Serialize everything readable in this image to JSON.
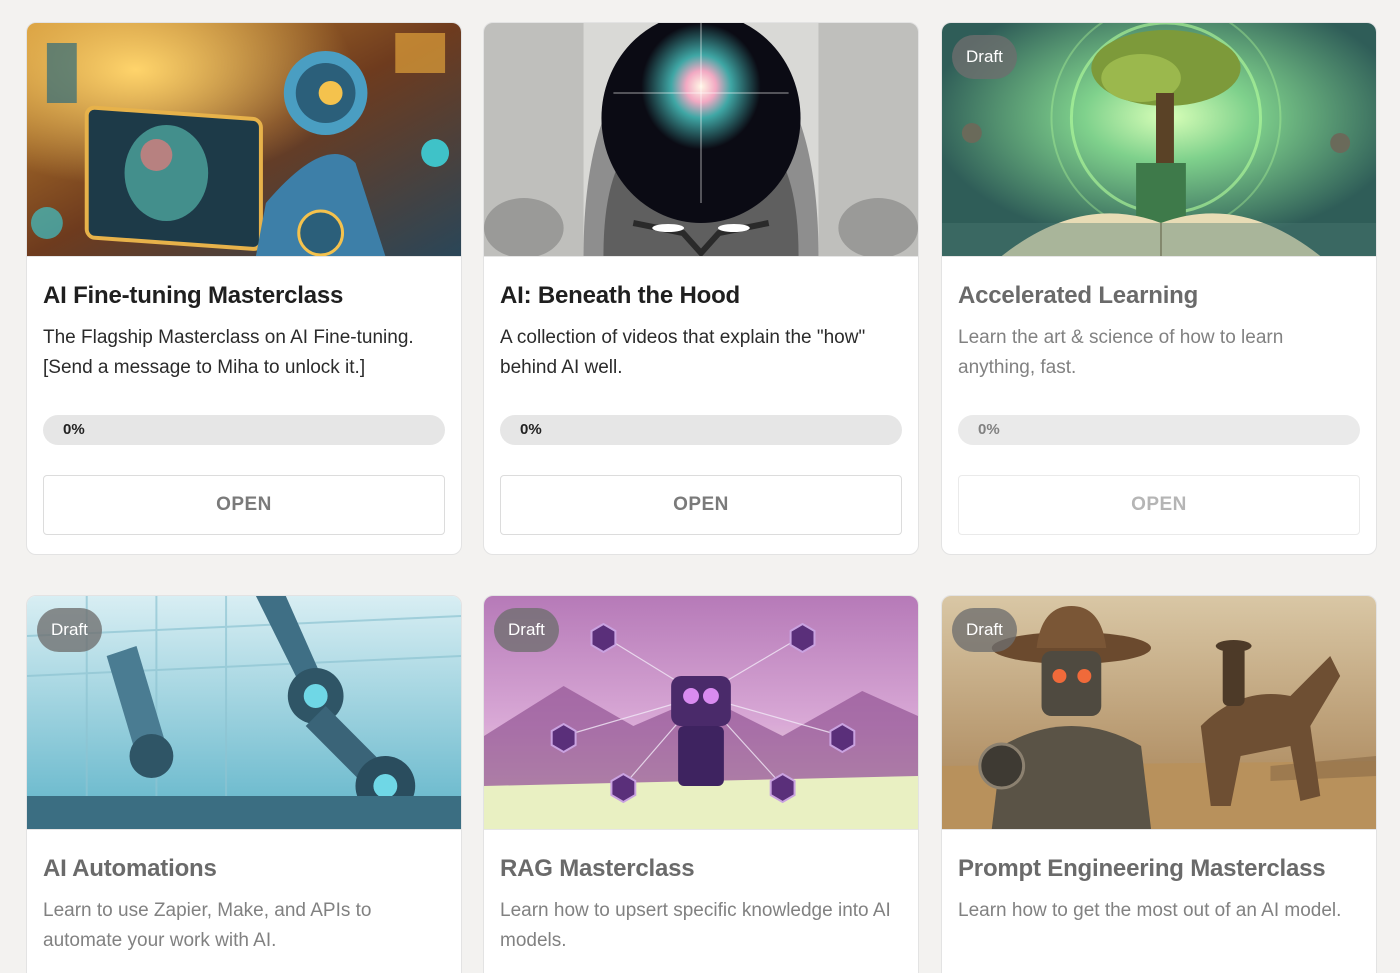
{
  "courses": [
    {
      "title": "AI Fine-tuning Masterclass",
      "description": "The Flagship Masterclass on AI Fine-tuning. [Send a message to Miha to unlock it.]",
      "progress_label": "0%",
      "progress": 0,
      "button_label": "OPEN",
      "draft": false,
      "image": "robot-anatomy-workshop-illustration"
    },
    {
      "title": "AI: Beneath the Hood",
      "description": "A collection of videos that explain the \"how\" behind AI well.",
      "progress_label": "0%",
      "progress": 0,
      "button_label": "OPEN",
      "draft": false,
      "image": "robot-head-galaxy-illustration"
    },
    {
      "title": "Accelerated Learning",
      "badge": "Draft",
      "description": "Learn the art & science of how to learn anything, fast.",
      "progress_label": "0%",
      "progress": 0,
      "button_label": "OPEN",
      "draft": true,
      "image": "tree-growing-from-book-illustration"
    },
    {
      "title": "AI Automations",
      "badge": "Draft",
      "description": "Learn to use Zapier, Make, and APIs to automate your work with AI.",
      "draft": true,
      "image": "robotic-factory-arms-illustration"
    },
    {
      "title": "RAG Masterclass",
      "badge": "Draft",
      "description": "Learn how to upsert specific knowledge into AI models.",
      "draft": true,
      "image": "hexagon-network-robot-illustration"
    },
    {
      "title": "Prompt Engineering Masterclass",
      "badge": "Draft",
      "description": "Learn how to get the most out of an AI model.",
      "draft": true,
      "image": "cowboy-robot-western-illustration"
    }
  ],
  "colors": {
    "page_background": "#f3f2f0",
    "card_background": "#ffffff",
    "progress_track": "#e6e6e6",
    "badge_background": "#6e6e6e",
    "button_text": "#7a7a7a"
  }
}
